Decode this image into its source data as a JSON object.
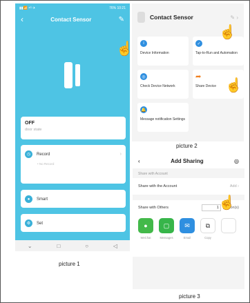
{
  "phone1": {
    "status_left": "▮▮📶 ⁴ᴳ ✈",
    "status_right": "76% 10:21",
    "back": "‹",
    "title": "Contact Sensor",
    "edit": "✎",
    "state_value": "OFF",
    "state_label": "door state",
    "record_label": "Record",
    "record_sub": "• No Record",
    "smart_label": "Smart",
    "set_label": "Set",
    "sys_nav": [
      "⌄",
      "□",
      "○",
      "◁"
    ],
    "caption": "picture 1"
  },
  "phone2": {
    "title": "Contact Sensor",
    "edit": "✎ ›",
    "tiles": [
      {
        "icon": "i",
        "label": "Device Information"
      },
      {
        "icon": "✓",
        "label": "Tap-to-Run and Automation"
      },
      {
        "icon": "◎",
        "label": "Check Device Network"
      },
      {
        "icon": "➦",
        "label": "Share Device"
      },
      {
        "icon": "🔔",
        "label": "Message notification Settings"
      }
    ],
    "caption": "picture 2"
  },
  "phone3": {
    "back": "‹",
    "title": "Add Sharing",
    "settings": "◎",
    "section_account": "Share with Account",
    "share_account": "Share with the Account",
    "add": "Add ›",
    "share_others": "Share with Others",
    "count": "1",
    "unit": "person(s)",
    "shares": [
      {
        "label": "WeChat",
        "color": "#43b94a",
        "glyph": "●"
      },
      {
        "label": "Messages",
        "color": "#37b54a",
        "glyph": "▢"
      },
      {
        "label": "Email",
        "color": "#2f8fe0",
        "glyph": "✉"
      },
      {
        "label": "Copy",
        "color": "#ffffff",
        "glyph": "⧉"
      },
      {
        "label": "",
        "color": "#ffffff",
        "glyph": ""
      }
    ],
    "caption": "picture 3"
  }
}
